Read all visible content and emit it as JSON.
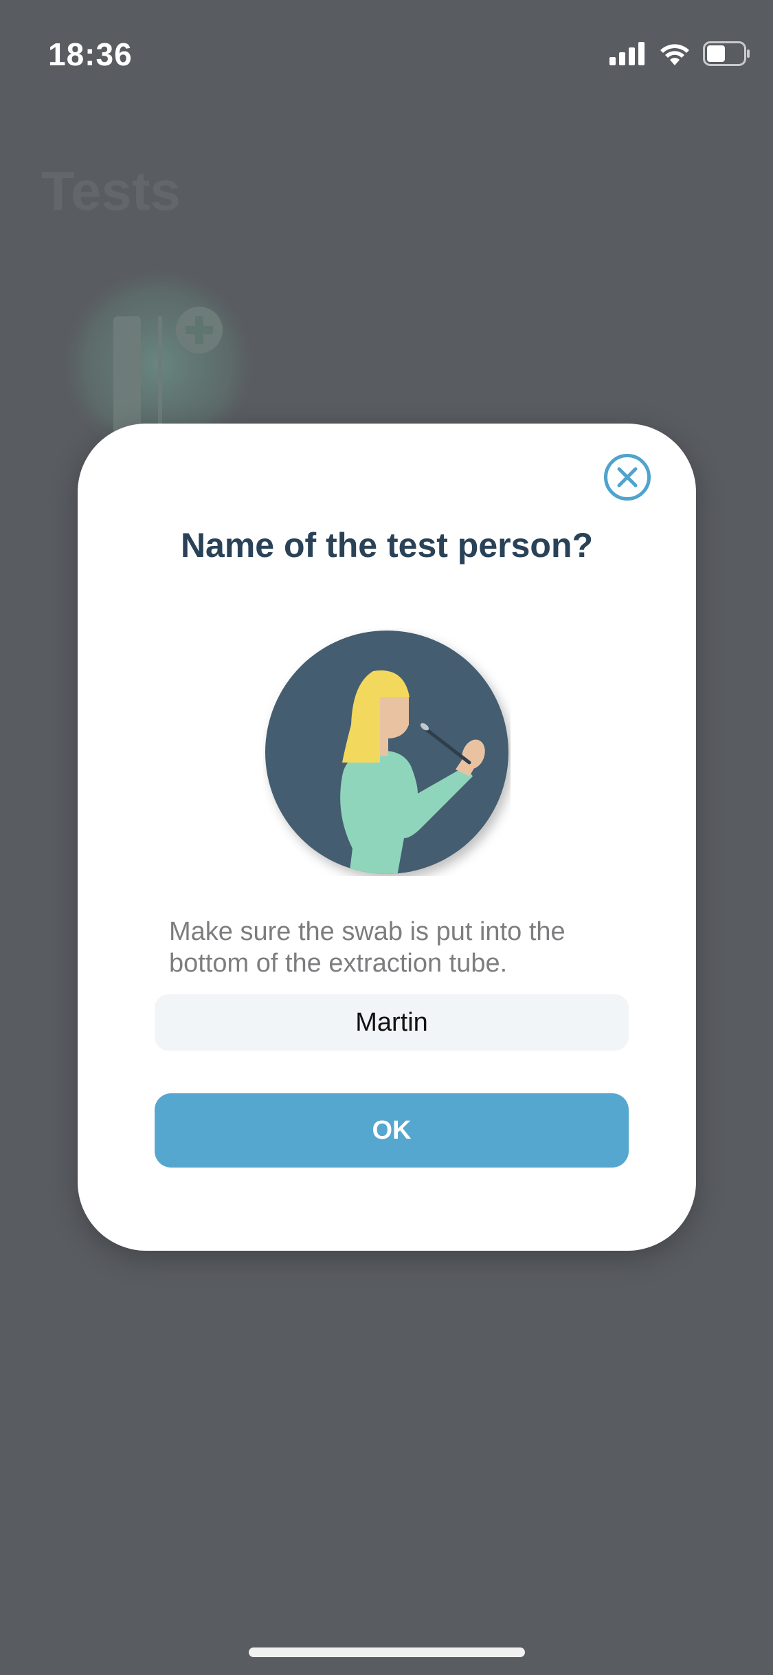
{
  "status_bar": {
    "time": "18:36",
    "icons": [
      "cellular-signal-icon",
      "wifi-icon",
      "battery-icon"
    ]
  },
  "background": {
    "title": "Tests",
    "card_icon": "test-tube-add-icon"
  },
  "modal": {
    "close_icon": "close-icon",
    "title": "Name of the test person?",
    "illustration": "person-swab-illustration",
    "instruction": "Make sure the swab is put into the bottom of the extraction tube.",
    "name_value": "Martin",
    "ok_label": "OK"
  },
  "colors": {
    "overlay": "#595c61",
    "accent": "#56a7cf",
    "title": "#2a4257",
    "illustration_bg": "#455d70"
  }
}
